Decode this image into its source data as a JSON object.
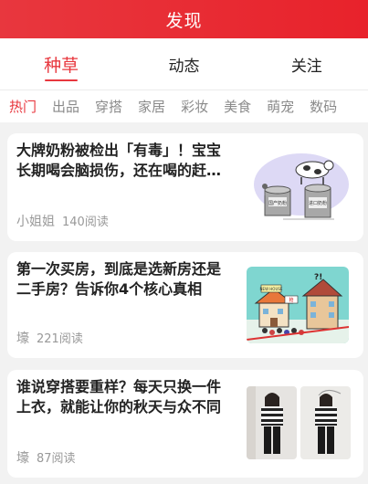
{
  "header": {
    "title": "发现"
  },
  "main_tabs": [
    {
      "label": "种草",
      "active": true
    },
    {
      "label": "动态",
      "active": false
    },
    {
      "label": "关注",
      "active": false
    }
  ],
  "sub_tabs": [
    {
      "label": "热门",
      "active": true
    },
    {
      "label": "出品"
    },
    {
      "label": "穿搭"
    },
    {
      "label": "家居"
    },
    {
      "label": "彩妆"
    },
    {
      "label": "美食"
    },
    {
      "label": "萌宠"
    },
    {
      "label": "数码"
    }
  ],
  "articles": [
    {
      "title": "大牌奶粉被检出「有毒」！宝宝长期喝会脑损伤，还在喝的赶…",
      "author": "小姐姐",
      "reads": "140阅读",
      "image": {
        "icon": "milk-cans-cow-illustration",
        "labels": [
          "国产奶粉",
          "进口奶粉"
        ]
      }
    },
    {
      "title": "第一次买房，到底是选新房还是二手房？告诉你4个核心真相",
      "author": "壕",
      "reads": "221阅读",
      "image": {
        "icon": "house-cartoon-illustration",
        "labels": [
          "NEW HOUSE",
          "抢"
        ]
      }
    },
    {
      "title": "谁说穿搭要重样？每天只换一件上衣，就能让你的秋天与众不同",
      "author": "壕",
      "reads": "87阅读",
      "image": {
        "icon": "fashion-photos"
      }
    }
  ],
  "colors": {
    "accent": "#e8373e"
  }
}
